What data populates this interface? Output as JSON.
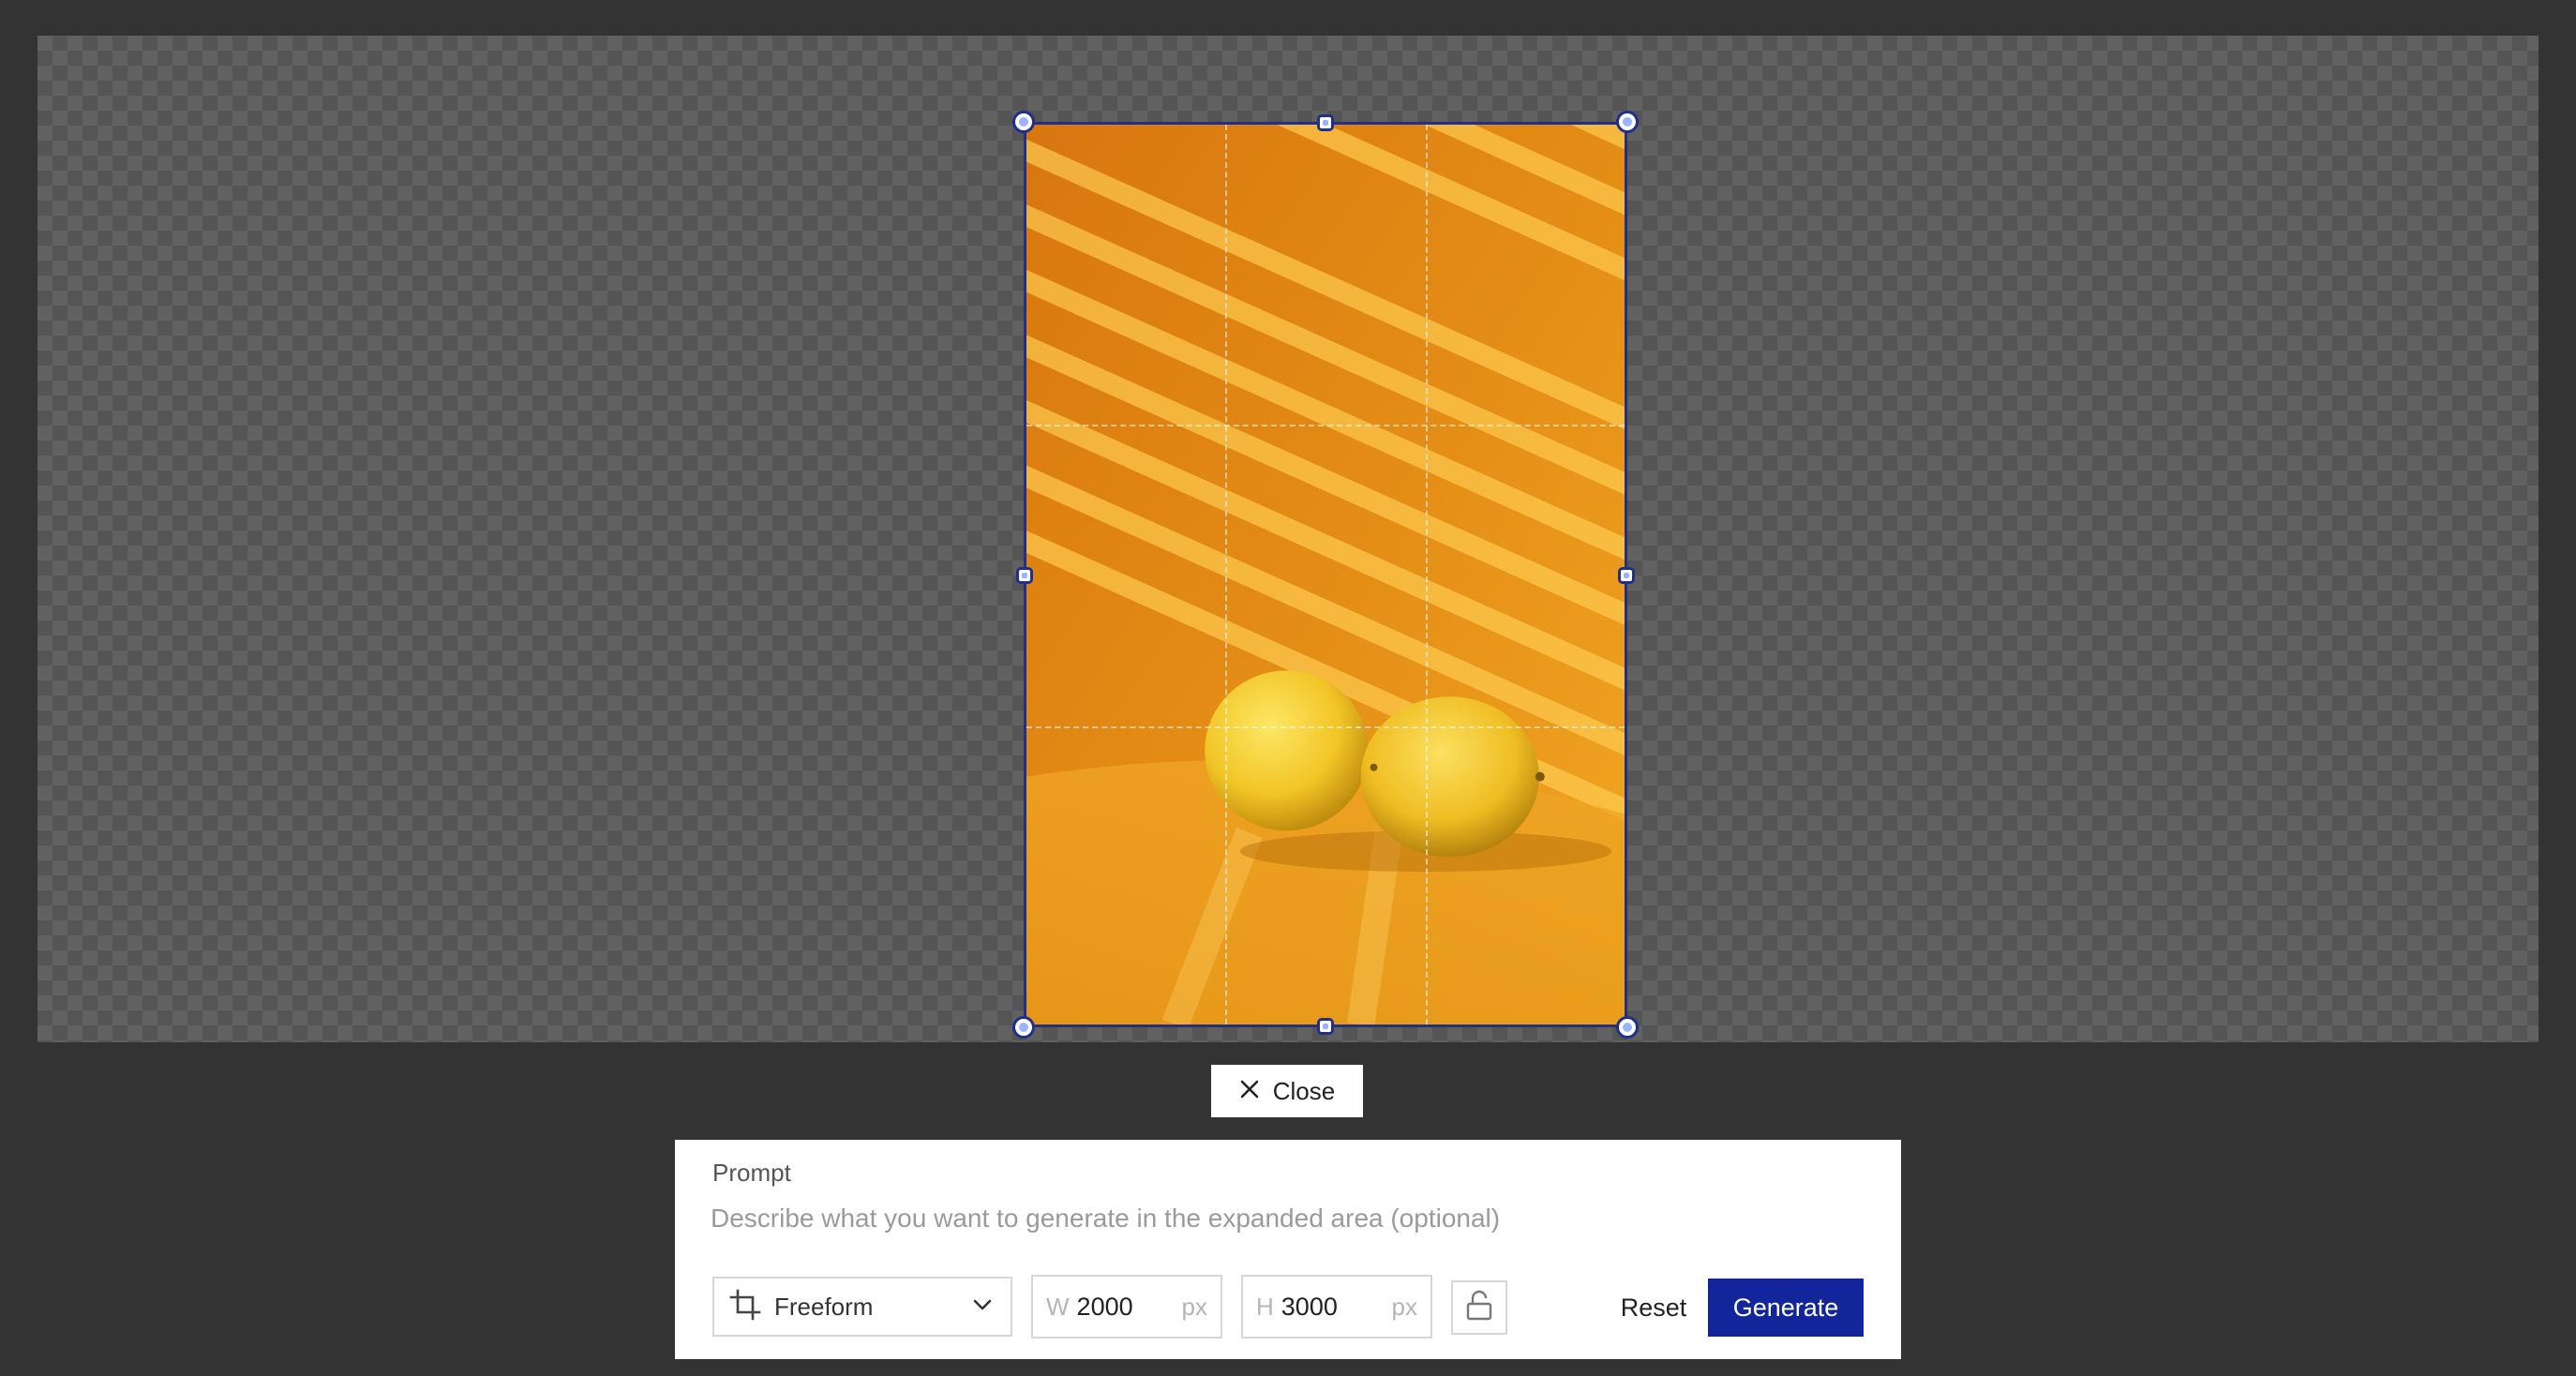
{
  "close_button": {
    "label": "Close",
    "icon": "close-icon"
  },
  "prompt": {
    "label": "Prompt",
    "placeholder": "Describe what you want to generate in the expanded area (optional)",
    "value": ""
  },
  "aspect_ratio": {
    "icon": "crop-icon",
    "selected": "Freeform"
  },
  "width_field": {
    "prefix": "W",
    "value": "2000",
    "unit": "px"
  },
  "height_field": {
    "prefix": "H",
    "value": "3000",
    "unit": "px"
  },
  "lock": {
    "icon": "unlock-icon"
  },
  "actions": {
    "reset_label": "Reset",
    "generate_label": "Generate"
  },
  "colors": {
    "accent": "#13259b",
    "frame_border": "#1e2f8c",
    "background": "#333333"
  }
}
